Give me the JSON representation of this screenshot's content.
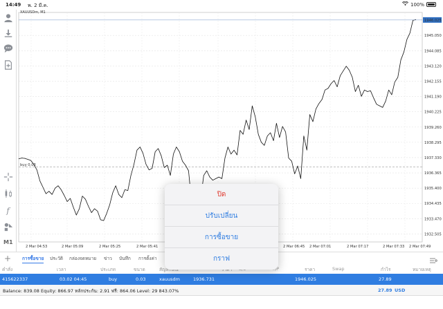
{
  "status_bar": {
    "time": "14:49",
    "date": "พ. 2 มี.ค.",
    "battery": "100%"
  },
  "sidebar": {
    "items": [
      {
        "name": "account-icon"
      },
      {
        "name": "download-icon"
      },
      {
        "name": "chat-icon"
      },
      {
        "name": "add-document-icon"
      },
      {
        "name": "crosshair-icon"
      },
      {
        "name": "candles-icon"
      },
      {
        "name": "function-icon"
      },
      {
        "name": "objects-icon"
      }
    ],
    "timeframe": "M1"
  },
  "chart": {
    "title": "XAUUSDm, M1",
    "buy_line_label": "buy 0.03",
    "price_labels": [
      "1946.025",
      "1945.050",
      "1944.085",
      "1943.120",
      "1942.155",
      "1941.190",
      "1940.225",
      "1939.260",
      "1938.295",
      "1937.330",
      "1936.365",
      "1935.400",
      "1934.435",
      "1933.470",
      "1932.505"
    ],
    "time_labels": [
      "2 Mar 04:53",
      "2 Mar 05:09",
      "2 Mar 05:25",
      "2 Mar 05:41",
      "2 Mar 06:45",
      "2 Mar 07:01",
      "2 Mar 07:17",
      "2 Mar 07:33",
      "2 Mar 07:49"
    ],
    "current_price": "1946.025"
  },
  "chart_data": {
    "type": "line",
    "title": "XAUUSDm, M1",
    "series": [
      {
        "name": "",
        "values": [
          1937.25,
          1937.3,
          1937.28,
          1937.22,
          1937.15,
          1936.9,
          1936.55,
          1935.85,
          1935.45,
          1935.05,
          1935.2,
          1935.0,
          1935.4,
          1935.55,
          1935.3,
          1934.95,
          1934.55,
          1934.75,
          1934.2,
          1933.7,
          1934.1,
          1934.9,
          1934.7,
          1934.25,
          1933.85,
          1934.1,
          1933.95,
          1933.4,
          1933.35,
          1933.8,
          1934.35,
          1935.1,
          1935.55,
          1935.0,
          1934.8,
          1935.3,
          1935.25,
          1936.2,
          1936.9,
          1937.8,
          1938.0,
          1937.6,
          1936.9,
          1936.55,
          1936.65,
          1937.7,
          1937.9,
          1937.45,
          1936.7,
          1936.85,
          1936.2,
          1937.55,
          1938.0,
          1937.7,
          1937.1,
          1936.85,
          1936.5,
          1934.5,
          1932.9,
          1934.0,
          1934.7,
          1936.2,
          1936.5,
          1936.1,
          1935.9,
          1936.0,
          1936.1,
          1936.0,
          1937.3,
          1938.0,
          1937.55,
          1937.8,
          1937.5,
          1939.05,
          1938.8,
          1939.7,
          1939.1,
          1940.6,
          1939.9,
          1938.8,
          1938.3,
          1938.1,
          1938.7,
          1938.9,
          1938.4,
          1939.5,
          1938.6,
          1939.3,
          1938.95,
          1937.3,
          1937.1,
          1936.3,
          1936.8,
          1936.0,
          1938.7,
          1937.8,
          1940.05,
          1939.6,
          1940.4,
          1940.75,
          1941.0,
          1941.6,
          1941.7,
          1942.0,
          1942.2,
          1941.8,
          1942.5,
          1942.8,
          1943.1,
          1942.85,
          1942.4,
          1941.5,
          1941.9,
          1941.2,
          1941.6,
          1941.5,
          1941.55,
          1941.1,
          1940.7,
          1940.6,
          1940.5,
          1940.9,
          1941.6,
          1941.3,
          1942.1,
          1942.4,
          1943.5,
          1944.0,
          1944.8,
          1945.2,
          1946.0,
          1946.05
        ]
      }
    ],
    "ylim": [
      1932.0,
      1946.5
    ],
    "grid": true
  },
  "tabs": [
    {
      "label": "การซื้อขาย",
      "active": true
    },
    {
      "label": "ประวัติ",
      "active": false
    },
    {
      "label": "กล่องจดหมาย",
      "active": false
    },
    {
      "label": "ข่าว",
      "active": false
    },
    {
      "label": "บันทึก",
      "active": false
    },
    {
      "label": "การตั้งค่า",
      "active": false
    }
  ],
  "columns": [
    "คำสั่ง",
    "เวลา",
    "ประเภท",
    "ขนาด",
    "สัญลักษณ์",
    "ราคา",
    "S/L",
    "T/P",
    "ราคา",
    "Swap",
    "กำไร",
    "หมายเหตุ"
  ],
  "order": {
    "ticket": "415622337",
    "time": "03.02 04:45",
    "type": "buy",
    "volume": "0.03",
    "symbol": "xauusdm",
    "open_price": "1936.731",
    "current_price": "1946.025",
    "profit": "27.89"
  },
  "balance": {
    "text": "Balance: 839.08 Equity: 866.97 หลักประกัน: 2.91 ฟรี: 864.06 Level: 29 843.07%",
    "profit": "27.89",
    "currency": "USD"
  },
  "popup": {
    "items": [
      "ปิด",
      "ปรับเปลี่ยน",
      "การซื้อขาย",
      "กราฟ"
    ]
  },
  "colors": {
    "accent": "#2f7de1",
    "danger": "#e03b30",
    "current_price_tag": "#2f6fc1"
  }
}
